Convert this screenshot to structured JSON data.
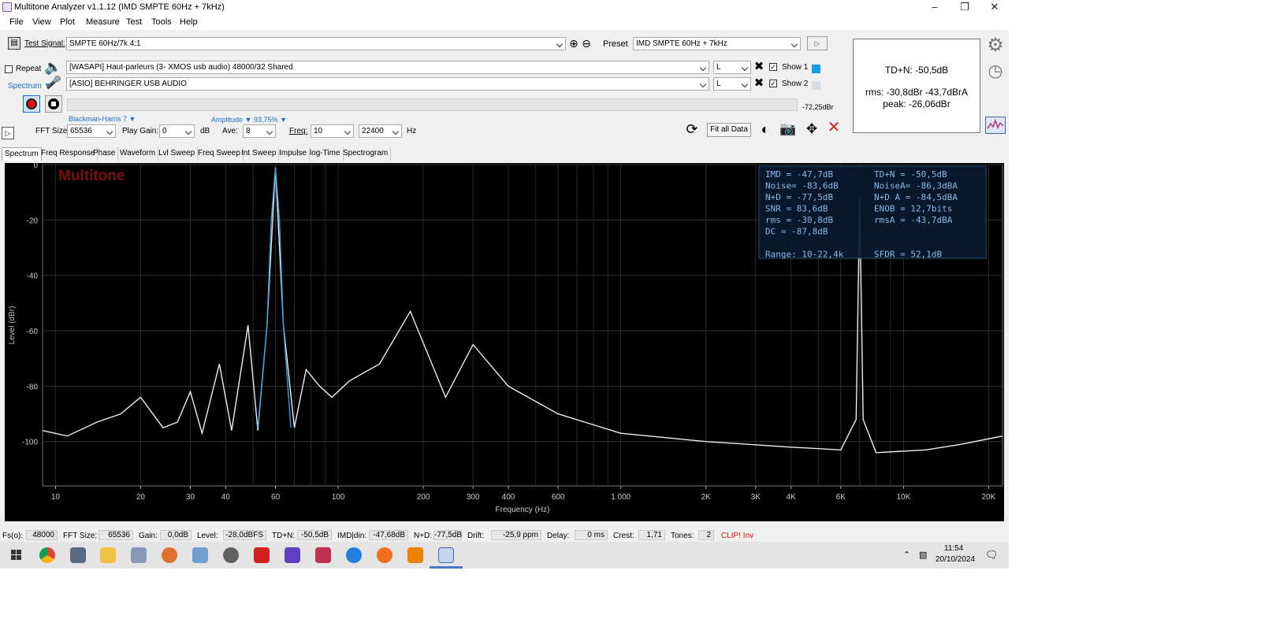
{
  "window": {
    "title": "Multitone Analyzer v1.1.12 (IMD SMPTE 60Hz + 7kHz)"
  },
  "menu": [
    "File",
    "View",
    "Plot",
    "Measure",
    "Test",
    "Tools",
    "Help"
  ],
  "toolbar": {
    "test_signal_label": "Test Signal:",
    "test_signal_value": "SMPTE 60Hz/7k 4:1",
    "preset_label": "Preset",
    "preset_value": "IMD SMPTE 60Hz + 7kHz",
    "repeat_label": "Repeat",
    "spectrum_label": "Spectrum",
    "output_device": "[WASAPI] Haut-parleurs (3- XMOS usb audio) 48000/32 Shared",
    "input_device": "[ASIO] BEHRINGER USB AUDIO",
    "output_channel": "L",
    "input_channel": "L",
    "show1_label": "Show 1",
    "show2_label": "Show 2",
    "level_readout": "-72,25dBr",
    "window_func": "Blackman-Harris 7",
    "amplitude_label": "Amplitude",
    "amplitude_value": "93,75%",
    "fft_size_label": "FFT Size:",
    "fft_size_value": "65536",
    "play_gain_label": "Play Gain:",
    "play_gain_value": "0",
    "play_gain_unit": "dB",
    "ave_label": "Ave:",
    "ave_value": "8",
    "freq_label": "Freq:",
    "freq_from": "10",
    "freq_to": "22400",
    "freq_unit": "Hz",
    "fit_all_label": "Fit all Data",
    "show1_color": "#1a9ae0",
    "show2_color": "#d8dde8"
  },
  "summary": {
    "tdn": "TD+N: -50,5dB",
    "rms": "rms: -30,8dBr  -43,7dBrA",
    "peak": "peak: -26,06dBr"
  },
  "tabs": [
    "Spectrum",
    "Freq Response",
    "Phase",
    "Waveform",
    "Lvl Sweep",
    "Freq Sweep",
    "Int Sweep",
    "Impulse",
    "log-Time",
    "Spectrogram"
  ],
  "chart_data": {
    "type": "line",
    "watermark": "Multitone",
    "xlabel": "Frequency (Hz)",
    "ylabel": "Level (dBr)",
    "x_scale": "log",
    "xlim": [
      9,
      22400
    ],
    "ylim": [
      -116,
      0
    ],
    "x_ticks": [
      10,
      20,
      30,
      40,
      60,
      100,
      200,
      300,
      400,
      600,
      1000,
      2000,
      3000,
      4000,
      6000,
      10000,
      20000
    ],
    "x_tick_labels": [
      "10",
      "20",
      "30",
      "40",
      "60",
      "100",
      "200",
      "300",
      "400",
      "600",
      "1 000",
      "2K",
      "3K",
      "4K",
      "6K",
      "10K",
      "20K"
    ],
    "y_ticks": [
      0,
      -20,
      -40,
      -60,
      -80,
      -100
    ],
    "y_tick_labels": [
      "0",
      "-20",
      "-40",
      "-60",
      "-80",
      "-100"
    ],
    "grid": true,
    "series": [
      {
        "color": "#e8eef6",
        "x": [
          9,
          11,
          14,
          17,
          20,
          24,
          27,
          30,
          33,
          38,
          42,
          48,
          52,
          56,
          60,
          64,
          70,
          77,
          86,
          95,
          110,
          140,
          180,
          240,
          300,
          400,
          600,
          1000,
          2000,
          4000,
          6000,
          6800,
          7000,
          7200,
          8000,
          12000,
          16000,
          22400
        ],
        "y": [
          -96,
          -98,
          -93,
          -90,
          -84,
          -95,
          -93,
          -82,
          -97,
          -72,
          -96,
          -58,
          -96,
          -58,
          -1,
          -58,
          -95,
          -74,
          -80,
          -84,
          -78,
          -72,
          -53,
          -84,
          -65,
          -80,
          -90,
          -97,
          -100,
          -102,
          -103,
          -92,
          -12,
          -92,
          -104,
          -103,
          -101,
          -98
        ]
      },
      {
        "color": "#3a9ed8",
        "x": [
          52,
          56,
          58,
          60,
          62,
          64,
          68
        ],
        "y": [
          -95,
          -58,
          -20,
          -1,
          -20,
          -58,
          -95
        ]
      }
    ]
  },
  "measurements": [
    [
      "IMD  = -47,7dB",
      "TD+N  = -50,5dB"
    ],
    [
      "Noise= -83,6dB",
      "NoiseA= -86,3dBA"
    ],
    [
      "N+D  = -77,5dB",
      "N+D A = -84,5dBA"
    ],
    [
      "SNR  =  83,6dB",
      "ENOB  =  12,7bits"
    ],
    [
      "rms  = -30,8dB",
      "rmsA  = -43,7dBA"
    ],
    [
      "DC   = -87,8dB",
      ""
    ],
    [
      "",
      ""
    ],
    [
      "Range:  10-22,4k",
      "SFDR  =  52,1dB"
    ]
  ],
  "status": [
    {
      "label": "Fs(o):",
      "value": "48000"
    },
    {
      "label": "FFT Size:",
      "value": "65536"
    },
    {
      "label": "Gain:",
      "value": "0,0dB"
    },
    {
      "label": "Level:",
      "value": "-28,0dBFS"
    },
    {
      "label": "TD+N:",
      "value": "-50,5dB"
    },
    {
      "label": "IMD|din:",
      "value": "-47,68dB"
    },
    {
      "label": "N+D:",
      "value": "-77,5dB"
    },
    {
      "label": "Drift:",
      "value": "-25,9  ppm"
    },
    {
      "label": "Delay:",
      "value": "0  ms"
    },
    {
      "label": "Crest:",
      "value": "1,71"
    },
    {
      "label": "Tones:",
      "value": "2"
    }
  ],
  "status_clip": "CLIP!  Inv",
  "clock": {
    "time": "11:54",
    "date": "20/10/2024"
  }
}
